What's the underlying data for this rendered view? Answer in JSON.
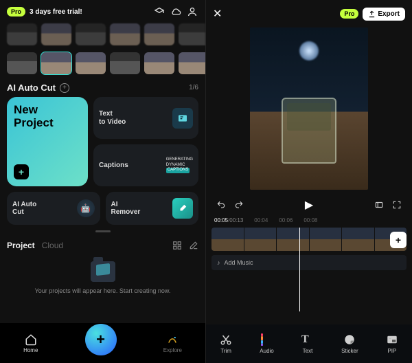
{
  "left": {
    "pro_badge": "Pro",
    "trial_text": "3 days free trial!",
    "section_title": "AI Auto Cut",
    "pager": "1/6",
    "new_project": "New\nProject",
    "text_to_video": "Text\nto Video",
    "captions": "Captions",
    "captions_gen_1": "GENERATING",
    "captions_gen_2": "DYNAMIC",
    "captions_gen_3": "CAPTIONS",
    "ai_auto_cut": "AI Auto\nCut",
    "ai_remover": "AI\nRemover",
    "tab_project": "Project",
    "tab_cloud": "Cloud",
    "empty_text": "Your projects will appear here. Start creating now.",
    "nav_home": "Home",
    "nav_explore": "Explore"
  },
  "right": {
    "pro_badge": "Pro",
    "export": "Export",
    "time_current": "00:05",
    "time_duration": "00:13",
    "marks": [
      "00:04",
      "00:06",
      "00:08"
    ],
    "add_music": "Add Music",
    "tools": {
      "trim": "Trim",
      "audio": "Audio",
      "text": "Text",
      "sticker": "Sticker",
      "pip": "PIP"
    }
  }
}
